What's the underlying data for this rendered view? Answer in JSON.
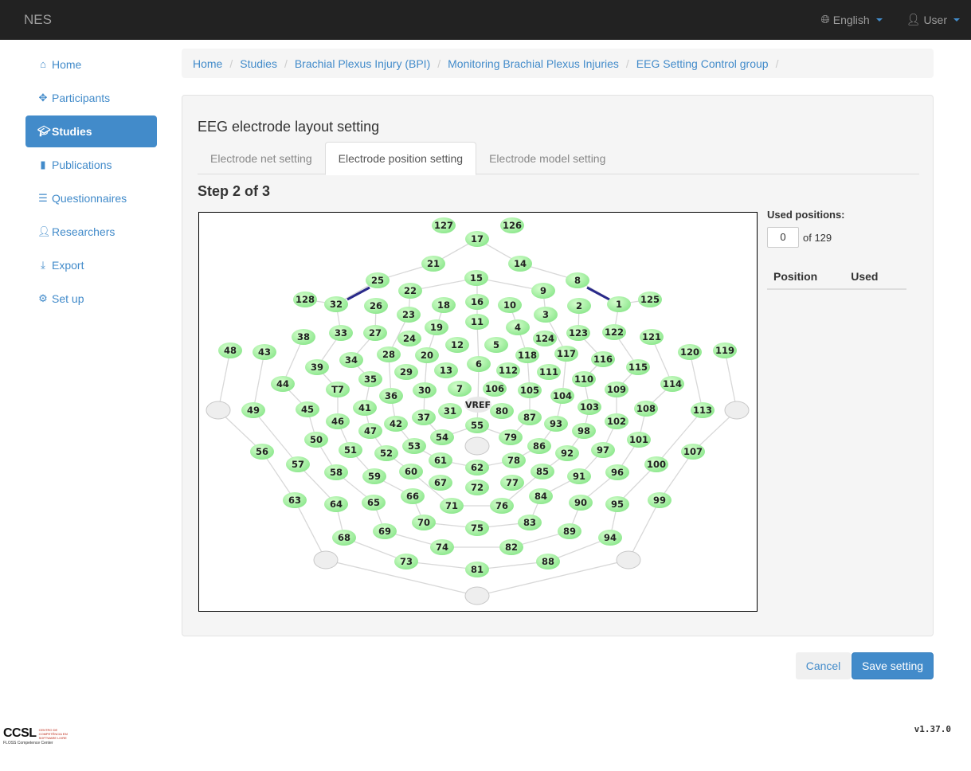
{
  "navbar": {
    "brand": "NES",
    "language": "English",
    "user": "User"
  },
  "sidebar": {
    "items": [
      {
        "label": "Home",
        "icon": "home-icon"
      },
      {
        "label": "Participants",
        "icon": "move-icon"
      },
      {
        "label": "Studies",
        "icon": "mortarboard-icon",
        "active": true
      },
      {
        "label": "Publications",
        "icon": "book-icon"
      },
      {
        "label": "Questionnaires",
        "icon": "list-icon"
      },
      {
        "label": "Researchers",
        "icon": "user-icon"
      },
      {
        "label": "Export",
        "icon": "export-icon"
      },
      {
        "label": "Set up",
        "icon": "gear-icon"
      }
    ]
  },
  "breadcrumb": [
    "Home",
    "Studies",
    "Brachial Plexus Injury (BPI)",
    "Monitoring Brachial Plexus Injuries",
    "EEG Setting Control group"
  ],
  "panel": {
    "title": "EEG electrode layout setting",
    "tabs": [
      "Electrode net setting",
      "Electrode position setting",
      "Electrode model setting"
    ],
    "step": "Step 2 of 3"
  },
  "used_positions": {
    "label": "Used positions:",
    "count": "0",
    "total": "of 129",
    "col_position": "Position",
    "col_used": "Used"
  },
  "electrode_labels": [
    "127",
    "126",
    "17",
    "21",
    "14",
    "25",
    "15",
    "8",
    "22",
    "9",
    "128",
    "32",
    "26",
    "16",
    "18",
    "10",
    "3",
    "2",
    "1",
    "125",
    "23",
    "38",
    "33",
    "27",
    "19",
    "11",
    "4",
    "124",
    "123",
    "122",
    "121",
    "48",
    "43",
    "24",
    "12",
    "5",
    "28",
    "20",
    "118",
    "117",
    "120",
    "119",
    "34",
    "6",
    "116",
    "39",
    "29",
    "13",
    "112",
    "111",
    "115",
    "110",
    "44",
    "35",
    "114",
    "7",
    "106",
    "105",
    "T7",
    "30",
    "36",
    "104",
    "109",
    "VREF",
    "41",
    "31",
    "80",
    "103",
    "45",
    "49",
    "108",
    "113",
    "37",
    "87",
    "46",
    "42",
    "93",
    "102",
    "55",
    "47",
    "98",
    "54",
    "79",
    "50",
    "53",
    "101",
    "86",
    "51",
    "97",
    "56",
    "52",
    "92",
    "78",
    "61",
    "107",
    "62",
    "57",
    "58",
    "59",
    "85",
    "60",
    "96",
    "91",
    "100",
    "67",
    "72",
    "77",
    "66",
    "84",
    "63",
    "64",
    "65",
    "99",
    "90",
    "71",
    "76",
    "95",
    "70",
    "83",
    "69",
    "75",
    "89",
    "68",
    "94",
    "74",
    "82",
    "73",
    "88",
    "81"
  ],
  "buttons": {
    "cancel": "Cancel",
    "save": "Save setting"
  },
  "footer": {
    "logo": "CCSL",
    "logo_sub": "CENTRO DE COMPETÊNCIA EM SOFTWARE LIVRE",
    "logo_tag": "FLOSS Competence Center",
    "version": "v1.37.0"
  },
  "colors": {
    "accent": "#428bca",
    "electrode": "#90e890",
    "selected_link": "#2a2a8a"
  }
}
